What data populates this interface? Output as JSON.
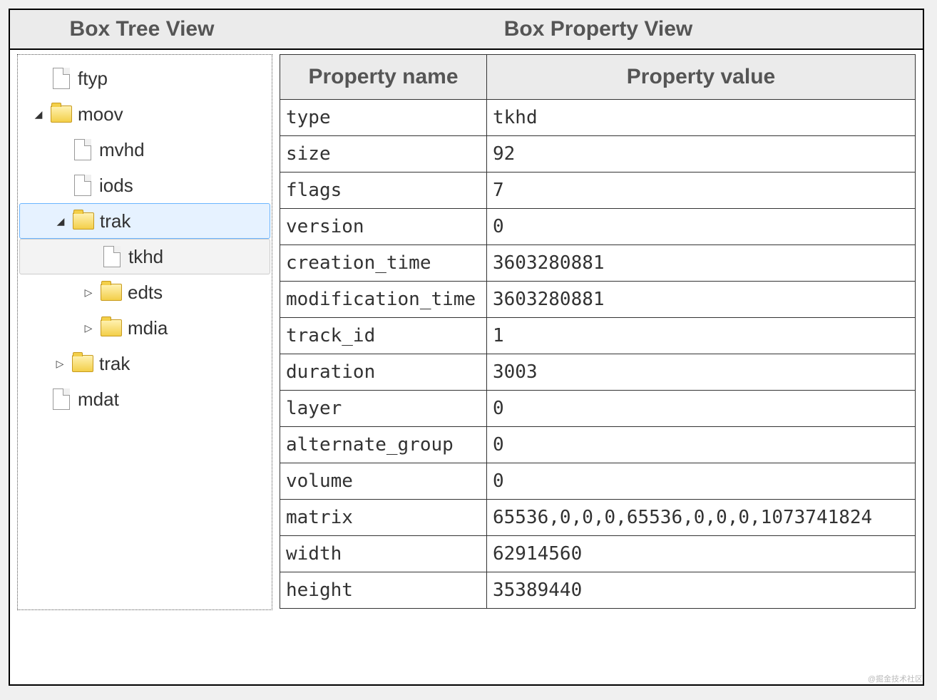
{
  "headers": {
    "tree": "Box Tree View",
    "props": "Box Property View"
  },
  "tree": [
    {
      "label": "ftyp",
      "icon": "file",
      "indent": 0,
      "disclosure": ""
    },
    {
      "label": "moov",
      "icon": "folder",
      "indent": 0,
      "disclosure": "◢"
    },
    {
      "label": "mvhd",
      "icon": "file",
      "indent": 1,
      "disclosure": ""
    },
    {
      "label": "iods",
      "icon": "file",
      "indent": 1,
      "disclosure": ""
    },
    {
      "label": "trak",
      "icon": "folder",
      "indent": 1,
      "disclosure": "◢",
      "state": "selected"
    },
    {
      "label": "tkhd",
      "icon": "file",
      "indent": 2,
      "disclosure": "",
      "state": "child-selected"
    },
    {
      "label": "edts",
      "icon": "folder",
      "indent": 2,
      "disclosure": "▷"
    },
    {
      "label": "mdia",
      "icon": "folder",
      "indent": 2,
      "disclosure": "▷"
    },
    {
      "label": "trak",
      "icon": "folder",
      "indent": 1,
      "disclosure": "▷"
    },
    {
      "label": "mdat",
      "icon": "file",
      "indent": 0,
      "disclosure": ""
    }
  ],
  "propHeaders": {
    "name": "Property name",
    "value": "Property value"
  },
  "properties": [
    {
      "name": "type",
      "value": "tkhd"
    },
    {
      "name": "size",
      "value": "92"
    },
    {
      "name": "flags",
      "value": "7"
    },
    {
      "name": "version",
      "value": "0"
    },
    {
      "name": "creation_time",
      "value": "3603280881"
    },
    {
      "name": "modification_time",
      "value": "3603280881"
    },
    {
      "name": "track_id",
      "value": "1"
    },
    {
      "name": "duration",
      "value": "3003"
    },
    {
      "name": "layer",
      "value": "0"
    },
    {
      "name": "alternate_group",
      "value": "0"
    },
    {
      "name": "volume",
      "value": "0"
    },
    {
      "name": "matrix",
      "value": "65536,0,0,0,65536,0,0,0,1073741824"
    },
    {
      "name": "width",
      "value": "62914560"
    },
    {
      "name": "height",
      "value": "35389440"
    }
  ],
  "watermark": "@掘金技术社区"
}
